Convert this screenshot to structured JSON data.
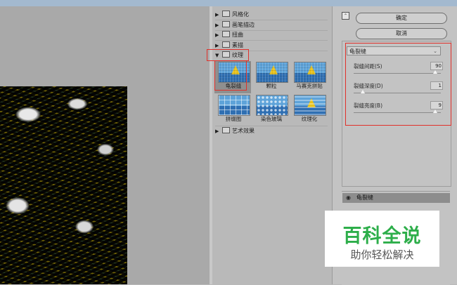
{
  "gallery": {
    "categories": {
      "wind": "风格化",
      "brush": "画笔描边",
      "distort": "扭曲",
      "sketch": "素描",
      "texture": "纹理",
      "artistic": "艺术效果"
    },
    "texture_filters": [
      "龟裂缝",
      "颗粒",
      "马赛克拼贴",
      "拼缀图",
      "染色玻璃",
      "纹理化"
    ],
    "expanded_category": "纹理",
    "selected_filter": "龟裂缝"
  },
  "actions": {
    "ok_label": "确定",
    "cancel_label": "取消",
    "collapse_glyph": "⌃"
  },
  "settings": {
    "filter_select": "龟裂缝",
    "params": [
      {
        "label": "裂缝间距(S)",
        "value": "90",
        "fraction": 0.86
      },
      {
        "label": "裂缝深度(D)",
        "value": "1",
        "fraction": 0.1
      },
      {
        "label": "裂缝亮度(B)",
        "value": "9",
        "fraction": 0.86
      }
    ]
  },
  "layers": {
    "active_layer": "龟裂缝"
  },
  "watermark": {
    "title": "百科全说",
    "subtitle": "助你轻松解决"
  },
  "colors": {
    "highlight_border": "#e0302a",
    "watermark_green": "#2dae4a"
  },
  "icons": {
    "expand": "triangle-right-icon",
    "collapse": "triangle-down-icon",
    "folder": "folder-icon",
    "visibility": "eye-icon"
  }
}
